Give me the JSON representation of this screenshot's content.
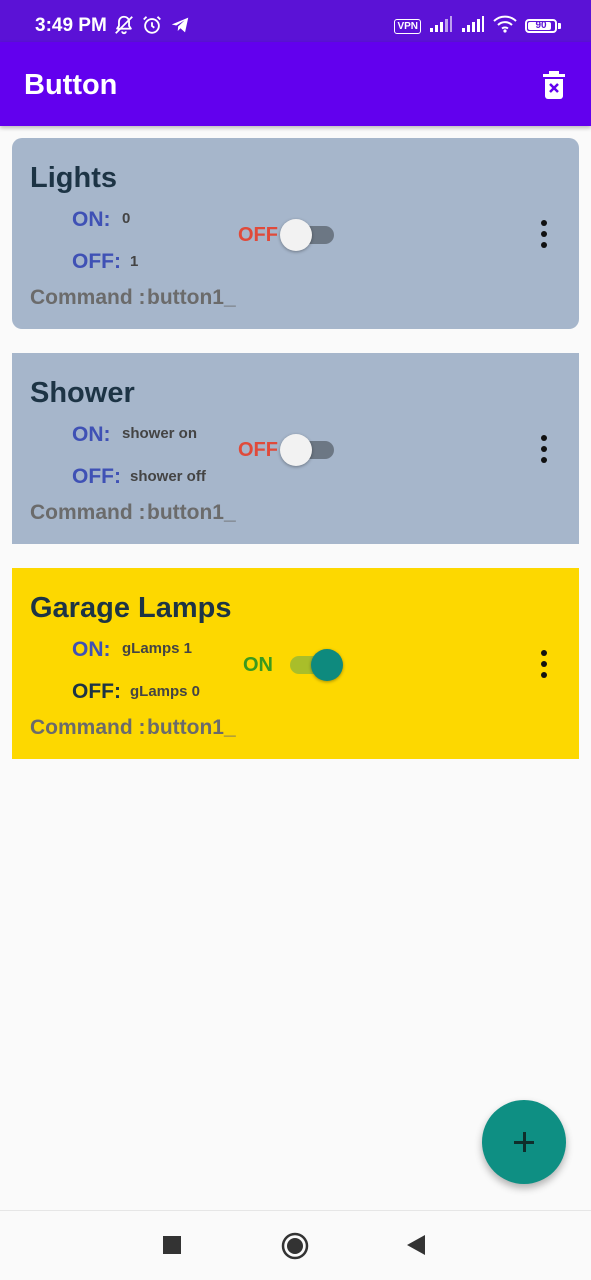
{
  "status_bar": {
    "time": "3:49 PM",
    "icons_left": [
      "bell-off-icon",
      "alarm-icon",
      "telegram-icon"
    ],
    "vpn": "VPN",
    "battery": "90",
    "battery_level": 0.9
  },
  "app_bar": {
    "title": "Button",
    "action_icon": "delete-sweep-icon"
  },
  "cards": [
    {
      "title": "Lights",
      "on_label": "ON:",
      "on_value": "0",
      "off_label": "OFF:",
      "off_value": "1",
      "command_label": "Command :",
      "command_value": "button1_",
      "state_text": "OFF",
      "switch_on": false,
      "background": "#a6b6cb"
    },
    {
      "title": "Shower",
      "on_label": "ON:",
      "on_value": "shower on",
      "off_label": "OFF:",
      "off_value": "shower off",
      "command_label": "Command :",
      "command_value": "button1_",
      "state_text": "OFF",
      "switch_on": false,
      "background": "#a6b6cb"
    },
    {
      "title": "Garage Lamps",
      "on_label": "ON:",
      "on_value": "gLamps 1",
      "off_label": "OFF:",
      "off_value": "gLamps 0",
      "command_label": "Command :",
      "command_value": "button1_",
      "state_text": "ON",
      "switch_on": true,
      "background": "#fdd800"
    }
  ],
  "fab": {
    "icon": "plus-icon"
  },
  "nav_bar": {
    "icons": [
      "recents-square-icon",
      "home-circle-icon",
      "back-triangle-icon"
    ]
  },
  "colors": {
    "status_bar": "#5b12d6",
    "app_bar": "#6200ee",
    "off_text": "#e04a3a",
    "on_text": "#3a9a1e",
    "switch_on_thumb": "#0e8a7e",
    "switch_on_track": "#a9be2a",
    "switch_off_thumb": "#f2f2f2",
    "switch_off_track": "#6c7784",
    "fab": "#0e8f83"
  }
}
